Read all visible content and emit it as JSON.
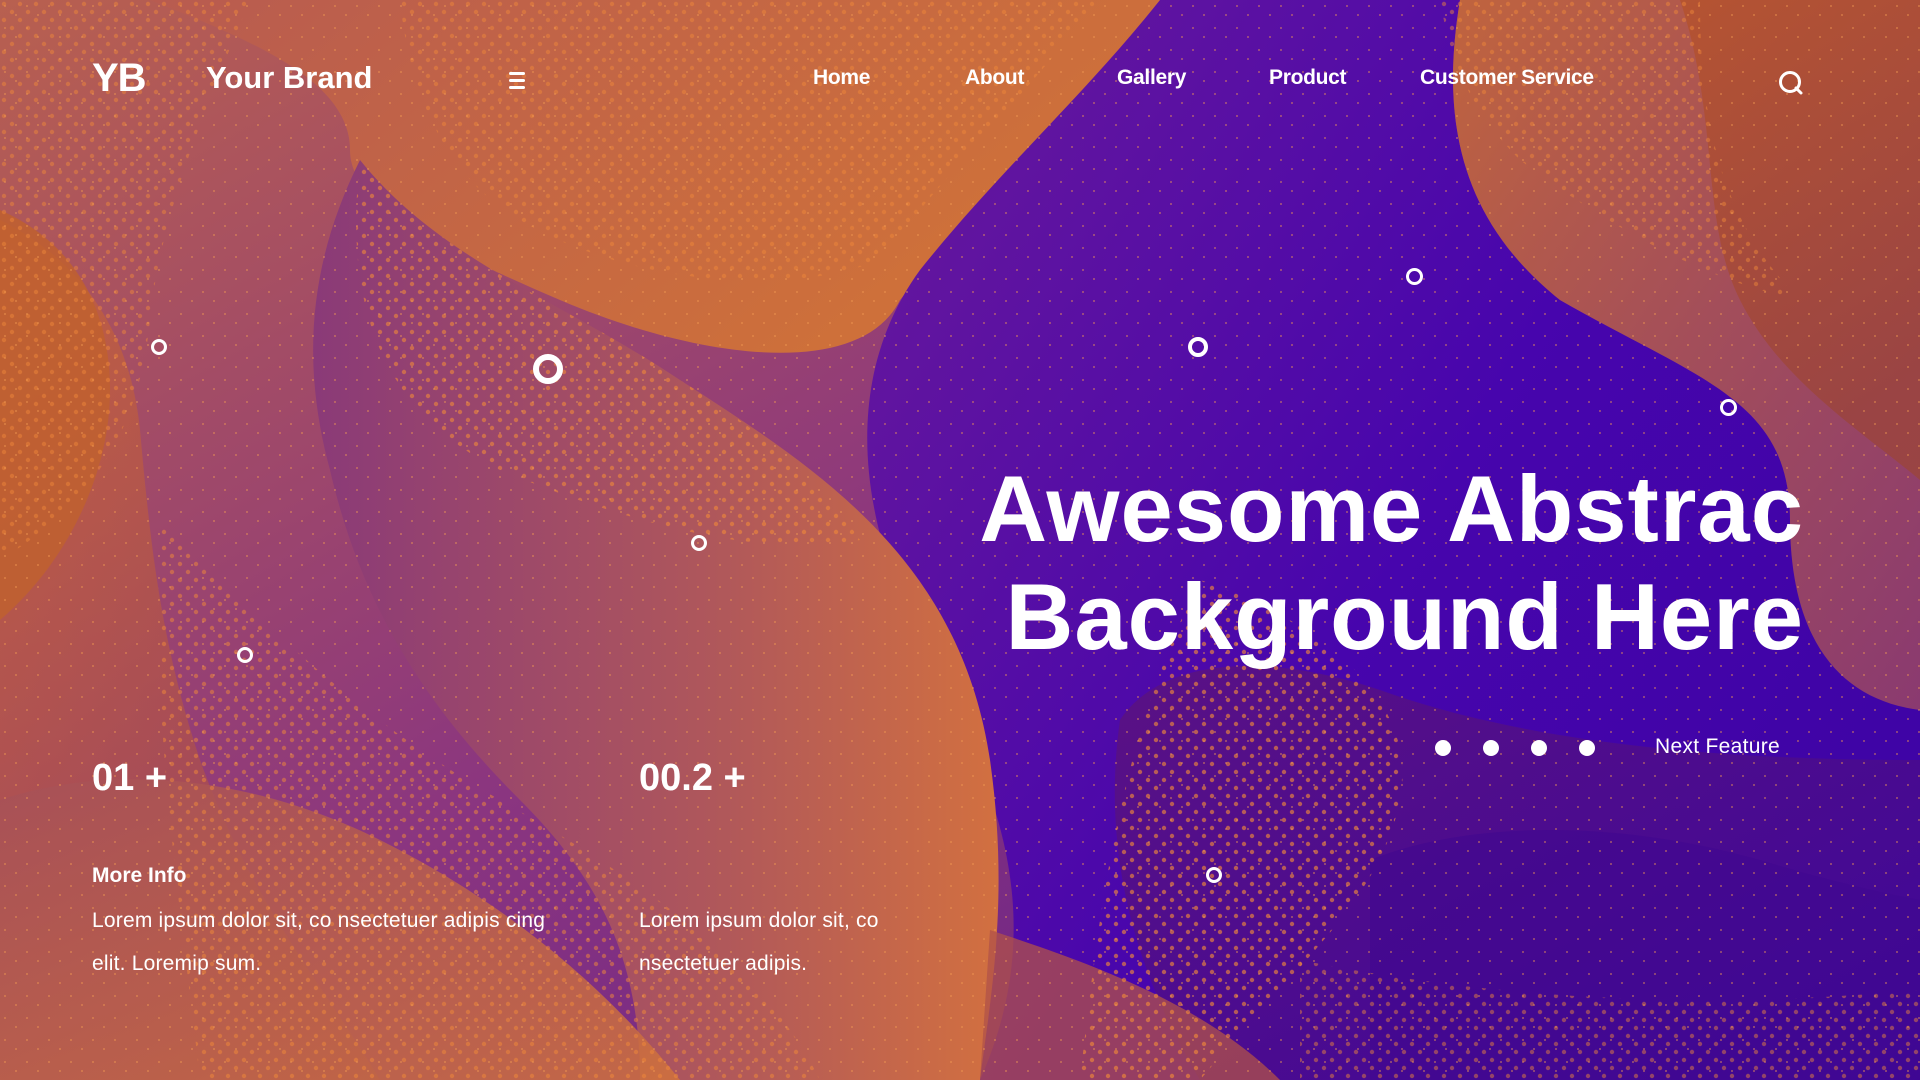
{
  "header": {
    "logo_mark": "YB",
    "brand_name": "Your Brand",
    "menu_icon": "hamburger-menu-icon",
    "nav": [
      {
        "label": "Home"
      },
      {
        "label": "About"
      },
      {
        "label": "Gallery"
      },
      {
        "label": "Product"
      },
      {
        "label": "Customer Service"
      }
    ],
    "search_icon": "search-icon"
  },
  "hero": {
    "title_line1": "Awesome Abstrac",
    "title_line2": "Background Here",
    "pager": {
      "count": 4
    },
    "next_label": "Next Feature"
  },
  "stats": [
    {
      "value": "01 +",
      "label": "More Info",
      "text_line1": "Lorem ipsum dolor sit, co nsectetuer adipis cing",
      "text_line2": "elit. Loremip sum."
    },
    {
      "value": "00.2 +",
      "label": "",
      "text_line1": "Lorem ipsum dolor sit, co",
      "text_line2": "nsectetuer adipis."
    }
  ],
  "colors": {
    "purple_deep": "#4a06b0",
    "purple_mid": "#7b2c86",
    "orange": "#d9702f",
    "rose": "#b25a5a",
    "dot_orange": "#f0883a",
    "text": "#ffffff"
  }
}
